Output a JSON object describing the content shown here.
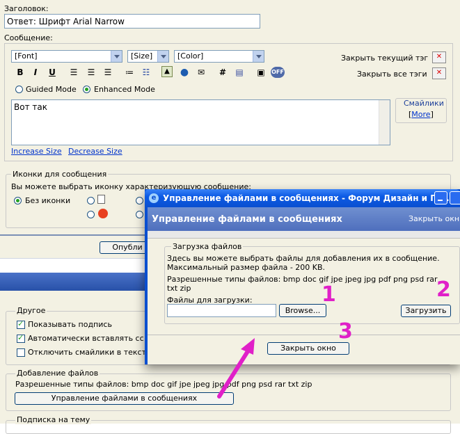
{
  "form": {
    "subject_label": "Заголовок:",
    "subject_value": "Ответ: Шрифт Arial Narrow",
    "message_label": "Сообщение:",
    "font_select": "[Font]",
    "size_select": "[Size]",
    "color_select": "[Color]",
    "close_current_tag": "Закрыть текущий тэг",
    "close_all_tags": "Закрыть все тэги",
    "toolbar_b": "B",
    "toolbar_i": "I",
    "toolbar_u": "U",
    "toolbar_hash": "#",
    "toolbar_off": "OFF",
    "mode_guided": "Guided Mode",
    "mode_enhanced": "Enhanced Mode",
    "message_text": "Вот так",
    "smilies_label": "Смайлики",
    "smilies_more_open": "[",
    "smilies_more": "More",
    "smilies_more_close": "]",
    "increase_size": "Increase Size",
    "decrease_size": "Decrease Size"
  },
  "icons_section": {
    "legend": "Иконки для сообщения",
    "desc": "Вы можете выбрать иконку характеризующую сообщение:",
    "no_icon": "Без иконки"
  },
  "publish_button": "Опубли",
  "other": {
    "legend": "Другое",
    "show_signature": "Показывать подпись",
    "auto_insert": "Автоматически вставлять сс",
    "disable_smilies": "Отключить смайлики в текст"
  },
  "attachments": {
    "legend": "Добавление файлов",
    "allowed": "Разрешенные типы файлов: bmp doc gif jpe jpeg jpg pdf png psd rar txt zip",
    "manage_button": "Управление файлами в сообщениях"
  },
  "subscribe_legend": "Подписка на тему",
  "dialog": {
    "window_title": "Управление файлами в сообщениях - Форум Дизайн и По...",
    "header_title": "Управление файлами в сообщениях",
    "header_close": "Закрыть окн",
    "upload_legend": "Загрузка файлов",
    "desc_line1": "Здесь вы можете выбрать файлы для добавления их в сообщение.",
    "desc_line2": "Максимальный размер файла - 200 KB.",
    "types_line1": "Разрешенные типы файлов: bmp doc gif jpe jpeg jpg pdf png psd rar",
    "types_line2": "txt zip",
    "files_label": "Файлы для загрузки:",
    "browse_button": "Browse...",
    "upload_button": "Загрузить",
    "close_button": "Закрыть окно"
  },
  "annotations": {
    "n1": "1",
    "n2": "2",
    "n3": "3",
    "arrow_color": "#e020c8"
  }
}
